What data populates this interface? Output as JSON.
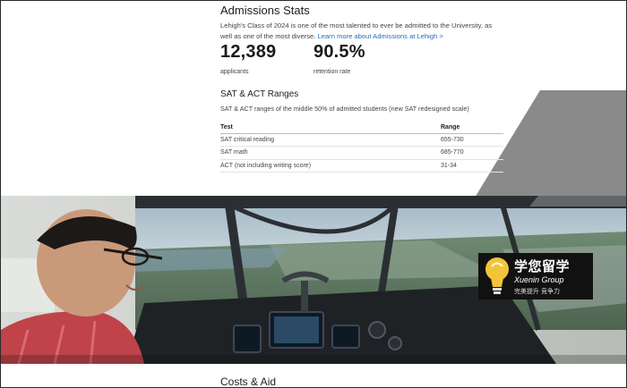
{
  "admissions": {
    "title": "Admissions Stats",
    "intro_text": "Lehigh's Class of 2024 is one of the most talented to ever be admitted to the University, as well as one of the most diverse.",
    "intro_link": "Learn more about Admissions at Lehigh >",
    "stats": [
      {
        "value": "12,389",
        "label": "applicants"
      },
      {
        "value": "90.5%",
        "label": "retention rate"
      }
    ]
  },
  "sat": {
    "title": "SAT & ACT Ranges",
    "description": "SAT & ACT ranges of the middle 50% of admitted students (new SAT redesigned scale)",
    "columns": [
      "Test",
      "Range"
    ],
    "rows": [
      {
        "test": "SAT critical reading",
        "range": "655-730"
      },
      {
        "test": "SAT math",
        "range": "685-770"
      },
      {
        "test": "ACT (not including writing score)",
        "range": "31-34"
      }
    ]
  },
  "watermark": {
    "title": "学您留学",
    "subtitle": "Xuenin Group",
    "tagline": "完美提升  竞争力"
  },
  "costs": {
    "title": "Costs & Aid"
  },
  "colors": {
    "link": "#2a6ebb",
    "deco_gray": "#8a8a8a"
  }
}
